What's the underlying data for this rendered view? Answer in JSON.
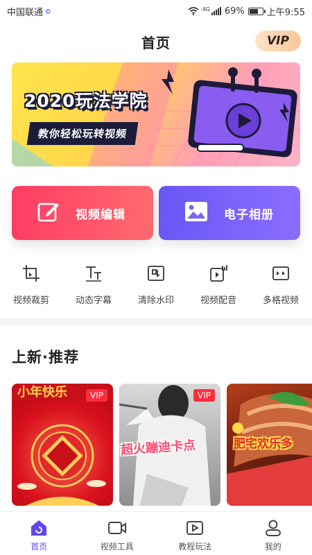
{
  "status_bar": {
    "carrier": "中国联通",
    "network": "4G",
    "battery": "69%",
    "battery_level": 0.69,
    "time": "上午9:55"
  },
  "header": {
    "title": "首页",
    "vip_label": "VIP"
  },
  "banner": {
    "title": "2020玩法学院",
    "subtitle": "教你轻松玩转视频"
  },
  "features": [
    {
      "label": "视频编辑",
      "icon": "edit-icon"
    },
    {
      "label": "电子相册",
      "icon": "image-icon"
    }
  ],
  "tools": [
    {
      "label": "视频裁剪",
      "icon": "crop-icon"
    },
    {
      "label": "动态字幕",
      "icon": "text-icon"
    },
    {
      "label": "清除水印",
      "icon": "watermark-icon"
    },
    {
      "label": "视频配音",
      "icon": "dubbing-icon"
    },
    {
      "label": "多格视频",
      "icon": "grid-video-icon"
    }
  ],
  "section": {
    "title": "上新·推荐"
  },
  "cards": [
    {
      "vip": "VIP",
      "caption": "小年快乐"
    },
    {
      "vip": "VIP",
      "caption": "超火蹦迪卡点"
    },
    {
      "vip": "",
      "caption": "肥宅欢乐多"
    }
  ],
  "bottom_nav": [
    {
      "label": "首页",
      "icon": "home-icon",
      "active": true
    },
    {
      "label": "视频工具",
      "icon": "video-camera-icon",
      "active": false
    },
    {
      "label": "教程玩法",
      "icon": "play-tutorial-icon",
      "active": false
    },
    {
      "label": "我的",
      "icon": "user-icon",
      "active": false
    }
  ],
  "colors": {
    "accent": "#5e48ee",
    "edit_gradient_start": "#ff3c63",
    "album_gradient_start": "#6a57f6",
    "vip_badge": "#ff2d3c"
  }
}
